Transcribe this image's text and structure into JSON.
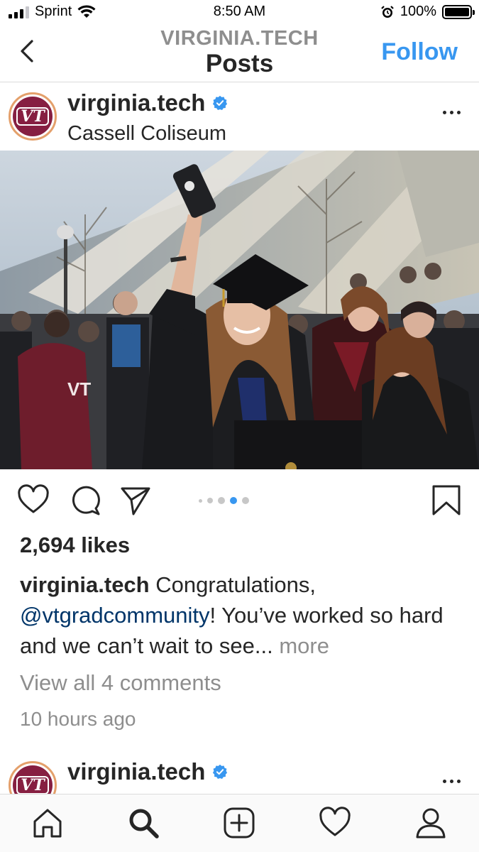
{
  "status_bar": {
    "carrier": "Sprint",
    "time": "8:50 AM",
    "battery": "100%",
    "battery_level": 1.0,
    "signal_bars": 3
  },
  "header": {
    "account": "VIRGINIA.TECH",
    "title": "Posts",
    "follow_label": "Follow",
    "back_icon": "chevron-left-icon"
  },
  "post": {
    "username": "virginia.tech",
    "verified": true,
    "location": "Cassell Coliseum",
    "likes": "2,694 likes",
    "caption_user": "virginia.tech",
    "caption_text_1": " Congratulations, ",
    "caption_mention": "@vtgradcommunity",
    "caption_text_2": "! You’ve worked so hard and we can’t wait to see...",
    "caption_more": " more",
    "view_comments": "View all 4 comments",
    "timestamp": "10 hours ago",
    "carousel": {
      "count": 5,
      "active": 4
    }
  },
  "next_post": {
    "username": "virginia.tech",
    "verified": true
  },
  "tab_bar": {
    "items": [
      "home-icon",
      "search-icon",
      "new-post-icon",
      "activity-heart-icon",
      "profile-icon"
    ],
    "active": "search-icon"
  },
  "colors": {
    "accent": "#3897f0",
    "mention": "#003569",
    "muted": "#8e8e8e",
    "brand_maroon": "#861f41",
    "avatar_ring": "#e4a06b"
  }
}
